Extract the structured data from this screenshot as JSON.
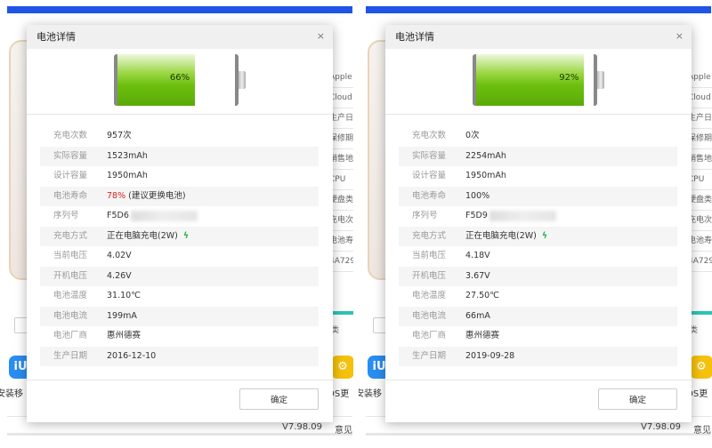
{
  "background": {
    "side_info": [
      "Apple",
      "Cloud",
      "生产日",
      "保修期",
      "销售地",
      "CPU",
      "硬盘类",
      "充电次",
      "电池寿",
      "4A729"
    ],
    "side_text": "类",
    "app_left_label": "安装移",
    "app_right_label": "OS更",
    "version": "V7.98.09",
    "feedback": "意见",
    "accent_color": "#1f54e6"
  },
  "panels": [
    {
      "dialog_title": "电池详情",
      "close_label": "×",
      "battery_percent": 66,
      "battery_label": "66%",
      "rows": [
        {
          "label": "充电次数",
          "value": "957次"
        },
        {
          "label": "实际容量",
          "value": "1523mAh"
        },
        {
          "label": "设计容量",
          "value": "1950mAh"
        },
        {
          "label": "电池寿命",
          "value": "(建议更换电池)",
          "highlight": "78%"
        },
        {
          "label": "序列号",
          "value": "F5D6"
        },
        {
          "label": "充电方式",
          "value": "正在电脑充电(2W)"
        },
        {
          "label": "当前电压",
          "value": "4.02V"
        },
        {
          "label": "开机电压",
          "value": "4.26V"
        },
        {
          "label": "电池温度",
          "value": "31.10℃"
        },
        {
          "label": "电池电流",
          "value": "199mA"
        },
        {
          "label": "电池厂商",
          "value": "惠州德赛"
        },
        {
          "label": "生产日期",
          "value": "2016-12-10"
        }
      ],
      "ok_label": "确定"
    },
    {
      "dialog_title": "电池详情",
      "close_label": "×",
      "battery_percent": 92,
      "battery_label": "92%",
      "rows": [
        {
          "label": "充电次数",
          "value": "0次"
        },
        {
          "label": "实际容量",
          "value": "2254mAh"
        },
        {
          "label": "设计容量",
          "value": "1950mAh"
        },
        {
          "label": "电池寿命",
          "value": "100%"
        },
        {
          "label": "序列号",
          "value": "F5D9"
        },
        {
          "label": "充电方式",
          "value": "正在电脑充电(2W)"
        },
        {
          "label": "当前电压",
          "value": "4.18V"
        },
        {
          "label": "开机电压",
          "value": "3.67V"
        },
        {
          "label": "电池温度",
          "value": "27.50℃"
        },
        {
          "label": "电池电流",
          "value": "66mA"
        },
        {
          "label": "电池厂商",
          "value": "惠州德赛"
        },
        {
          "label": "生产日期",
          "value": "2019-09-28"
        }
      ],
      "ok_label": "确定"
    }
  ]
}
